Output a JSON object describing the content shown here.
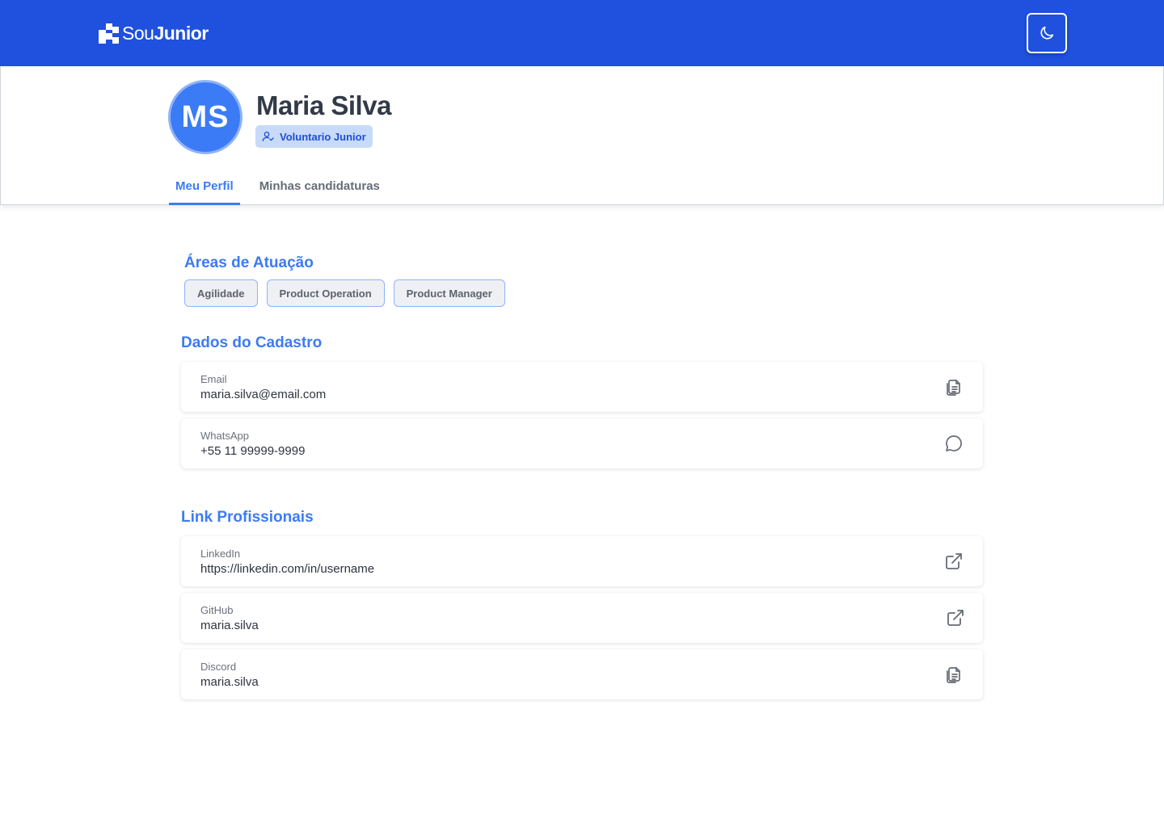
{
  "brand": {
    "name_light": "Sou",
    "name_bold": "Junior"
  },
  "header": {
    "theme_toggle_icon": "moon-icon"
  },
  "profile": {
    "initials": "MS",
    "name": "Maria Silva",
    "role": "Voluntario Junior",
    "tabs": [
      {
        "label": "Meu Perfil",
        "active": true
      },
      {
        "label": "Minhas candidaturas",
        "active": false
      }
    ]
  },
  "areas": {
    "title": "Áreas de Atuação",
    "items": [
      "Agilidade",
      "Product Operation",
      "Product Manager"
    ]
  },
  "cadastro": {
    "title": "Dados do Cadastro",
    "fields": [
      {
        "label": "Email",
        "value": "maria.silva@email.com",
        "icon": "copy-icon"
      },
      {
        "label": "WhatsApp",
        "value": "+55 11 99999-9999",
        "icon": "chat-icon"
      }
    ]
  },
  "links": {
    "title": "Link Profissionais",
    "fields": [
      {
        "label": "LinkedIn",
        "value": "https://linkedin.com/in/username",
        "icon": "external-link-icon"
      },
      {
        "label": "GitHub",
        "value": "maria.silva",
        "icon": "external-link-icon"
      },
      {
        "label": "Discord",
        "value": "maria.silva",
        "icon": "copy-icon"
      }
    ]
  },
  "colors": {
    "brand_blue": "#1f51de",
    "accent_blue": "#3b7bf5",
    "badge_bg": "#c8daf9"
  }
}
